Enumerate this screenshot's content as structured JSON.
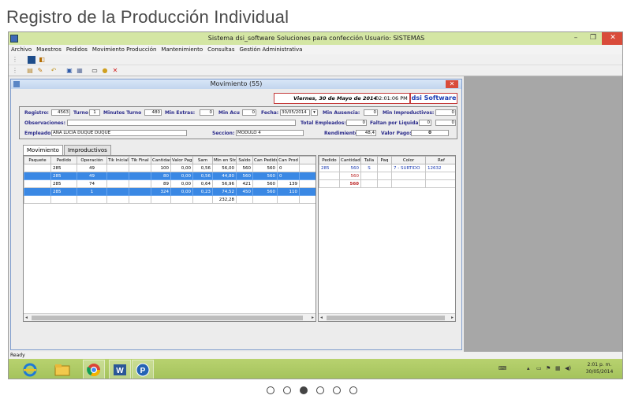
{
  "page": {
    "heading": "Registro de la Producción Individual"
  },
  "app": {
    "title": "Sistema dsi_software    Soluciones para confección    Usuario: SISTEMAS",
    "window_buttons": [
      "–",
      "❐",
      "✕"
    ],
    "menu": [
      "Archivo",
      "Maestros",
      "Pedidos",
      "Movimiento Producción",
      "Mantenimiento",
      "Consultas",
      "Gestión Administrativa"
    ],
    "status": "Ready"
  },
  "child": {
    "title": "Movimiento (55)",
    "date": "Viernes, 30 de Mayo de 2014",
    "time": "02:01:06 PM",
    "brand": "dsi Software"
  },
  "form": {
    "registro_label": "Registro:",
    "registro": "4563",
    "turno_label": "Turno",
    "turno": "1",
    "min_turno_label": "Minutos Turno",
    "min_turno": "480",
    "min_extras_label": "Min Extras:",
    "min_extras": "0",
    "min_acu_label": "Min Acu",
    "min_acu": "0",
    "fecha_label": "Fecha:",
    "fecha": "30/05/2014",
    "min_ausencia_label": "Min Ausencia:",
    "min_ausencia": "0",
    "min_improd_label": "Min Improductivos:",
    "min_improd": "0",
    "observaciones_label": "Observaciones:",
    "observaciones": "",
    "total_emp_label": "Total Empleados:",
    "total_emp": "0",
    "faltan_label": "Faltan por Liquidar:",
    "faltan_a": "0",
    "faltan_b": "0",
    "empleado_label": "Empleado:",
    "empleado": "ANA LUCIA DUQUE DUQUE",
    "seccion_label": "Seccion:",
    "seccion": "MODULO 4",
    "rendimiento_label": "Rendimiento:",
    "rendimiento": "48,4",
    "valor_pago_label": "Valor Pago:",
    "valor_pago": "0"
  },
  "tabs": [
    "Movimiento",
    "Improductivos"
  ],
  "grid": {
    "columns": [
      "Paquete",
      "Pedido",
      "Operación",
      "Tik Inicial",
      "Tik Final",
      "Cantidad",
      "Valor Pago",
      "Sam",
      "Min en Std",
      "Saldo",
      "Can Pedido",
      "Can Prod"
    ],
    "rows": [
      [
        "",
        "285",
        "49",
        "",
        "",
        "100",
        "0,00",
        "0,56",
        "56,00",
        "560",
        "560",
        "0"
      ],
      [
        "",
        "285",
        "49",
        "",
        "",
        "80",
        "0,00",
        "0,56",
        "44,80",
        "560",
        "560",
        "0"
      ],
      [
        "",
        "285",
        "74",
        "",
        "",
        "89",
        "0,00",
        "0,64",
        "56,96",
        "421",
        "560",
        "139"
      ],
      [
        "",
        "285",
        "1",
        "",
        "",
        "324",
        "0,00",
        "0,23",
        "74,52",
        "450",
        "560",
        "110"
      ]
    ],
    "total_min": "232,28"
  },
  "grid2": {
    "columns": [
      "Pedido",
      "Cantidad",
      "Talla",
      "Paq",
      "Color",
      "Ref"
    ],
    "row": [
      "285",
      "560",
      "S",
      "",
      "7 - SURTIDO",
      "12632"
    ],
    "subtotal": "560",
    "total": "560"
  },
  "taskbar": {
    "apps": [
      "ie-icon",
      "explorer-icon",
      "chrome-icon",
      "word-icon",
      "app-p-icon"
    ],
    "clock_time": "2:01 p. m.",
    "clock_date": "30/05/2014"
  },
  "carousel": {
    "count": 6,
    "active": 3
  }
}
